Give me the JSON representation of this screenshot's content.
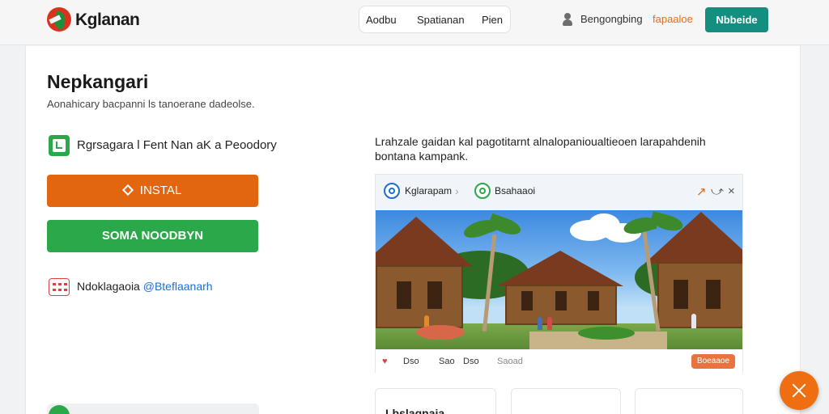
{
  "header": {
    "brand": "Kglanan",
    "nav": [
      "Aodbu",
      "Spatianan",
      "Pien"
    ],
    "signin": "Bengongbing",
    "link": "fapaaloe",
    "cta": "Nbbeide"
  },
  "main": {
    "title": "Nepkangari",
    "subtitle": "Aonahicary bacpanni ls tanoerane dadeolse.",
    "feature": "Rgrsagara l Fent Nan aK a Peoodory",
    "install_label": "INSTAL",
    "secondary_label": "SOMA NOODBYN",
    "contact_label": "Ndoklagaoia",
    "contact_handle": "@Bteflaanarh"
  },
  "description": "Lrahzale gaidan kal pagotitarnt alnalopanioualtieoen larapahdenih bontana kampank.",
  "preview": {
    "crumbs": [
      "Kglarapam",
      "Bsahaaoi"
    ],
    "controls": [
      "↗",
      "⤻",
      "×"
    ],
    "footer": [
      "Dso",
      "Sao",
      "Dso",
      "Saoad"
    ],
    "action_label": "Boeaaoe"
  },
  "cards": [
    "Lbslagnaia",
    "",
    ""
  ],
  "colors": {
    "orange": "#e2650f",
    "green": "#2aa84a",
    "teal": "#148f7f",
    "link_blue": "#1f6fcf"
  }
}
